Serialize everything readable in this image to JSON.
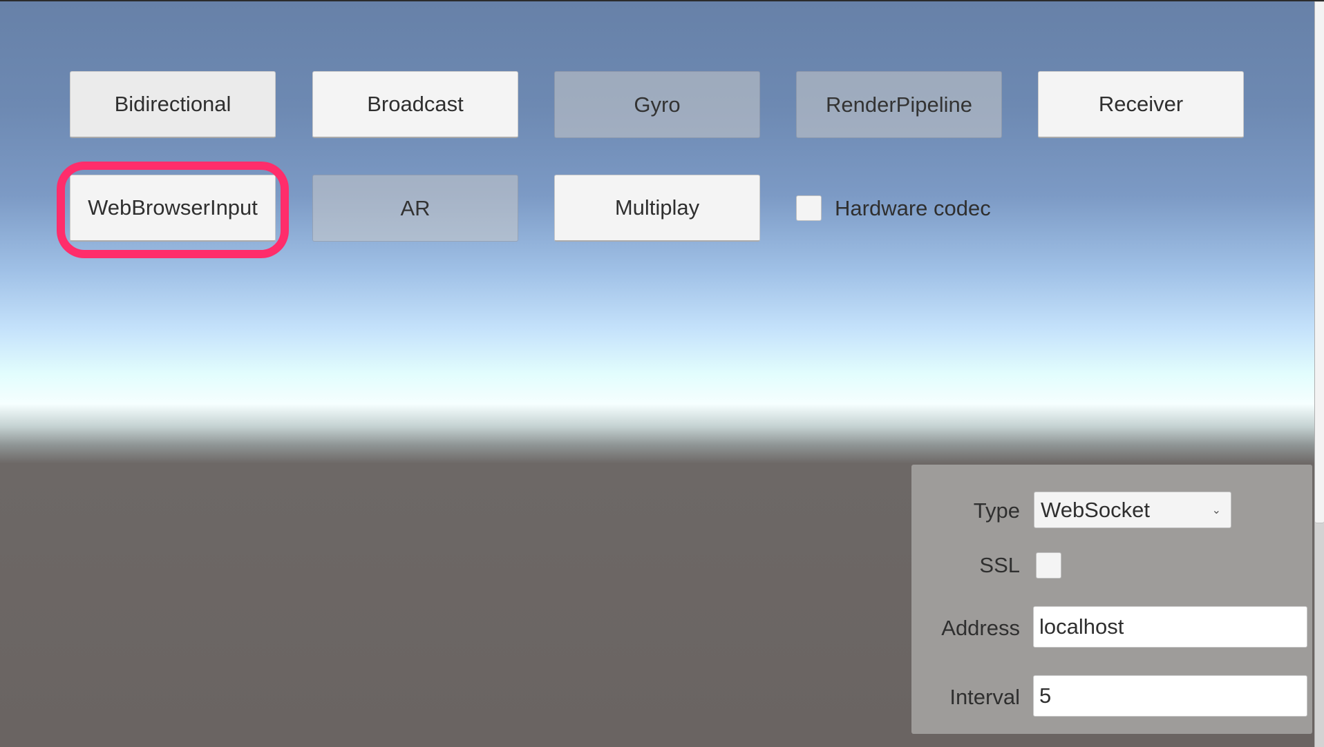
{
  "scenes": {
    "row1": [
      {
        "id": "bidirectional",
        "label": "Bidirectional",
        "enabled": true
      },
      {
        "id": "broadcast",
        "label": "Broadcast",
        "enabled": true
      },
      {
        "id": "gyro",
        "label": "Gyro",
        "enabled": false
      },
      {
        "id": "renderpipeline",
        "label": "RenderPipeline",
        "enabled": false
      },
      {
        "id": "receiver",
        "label": "Receiver",
        "enabled": true
      }
    ],
    "row2": [
      {
        "id": "webbrowserinput",
        "label": "WebBrowserInput",
        "enabled": true,
        "highlighted": true
      },
      {
        "id": "ar",
        "label": "AR",
        "enabled": false
      },
      {
        "id": "multiplay",
        "label": "Multiplay",
        "enabled": true
      }
    ]
  },
  "hardware_codec": {
    "label": "Hardware codec",
    "checked": false
  },
  "highlight_color": "#ff2d6b",
  "signaling": {
    "type_label": "Type",
    "type_value": "WebSocket",
    "ssl_label": "SSL",
    "ssl_checked": false,
    "address_label": "Address",
    "address_value": "localhost",
    "interval_label": "Interval",
    "interval_value": "5"
  },
  "icons": {
    "dropdown_chevron": "⌄"
  }
}
